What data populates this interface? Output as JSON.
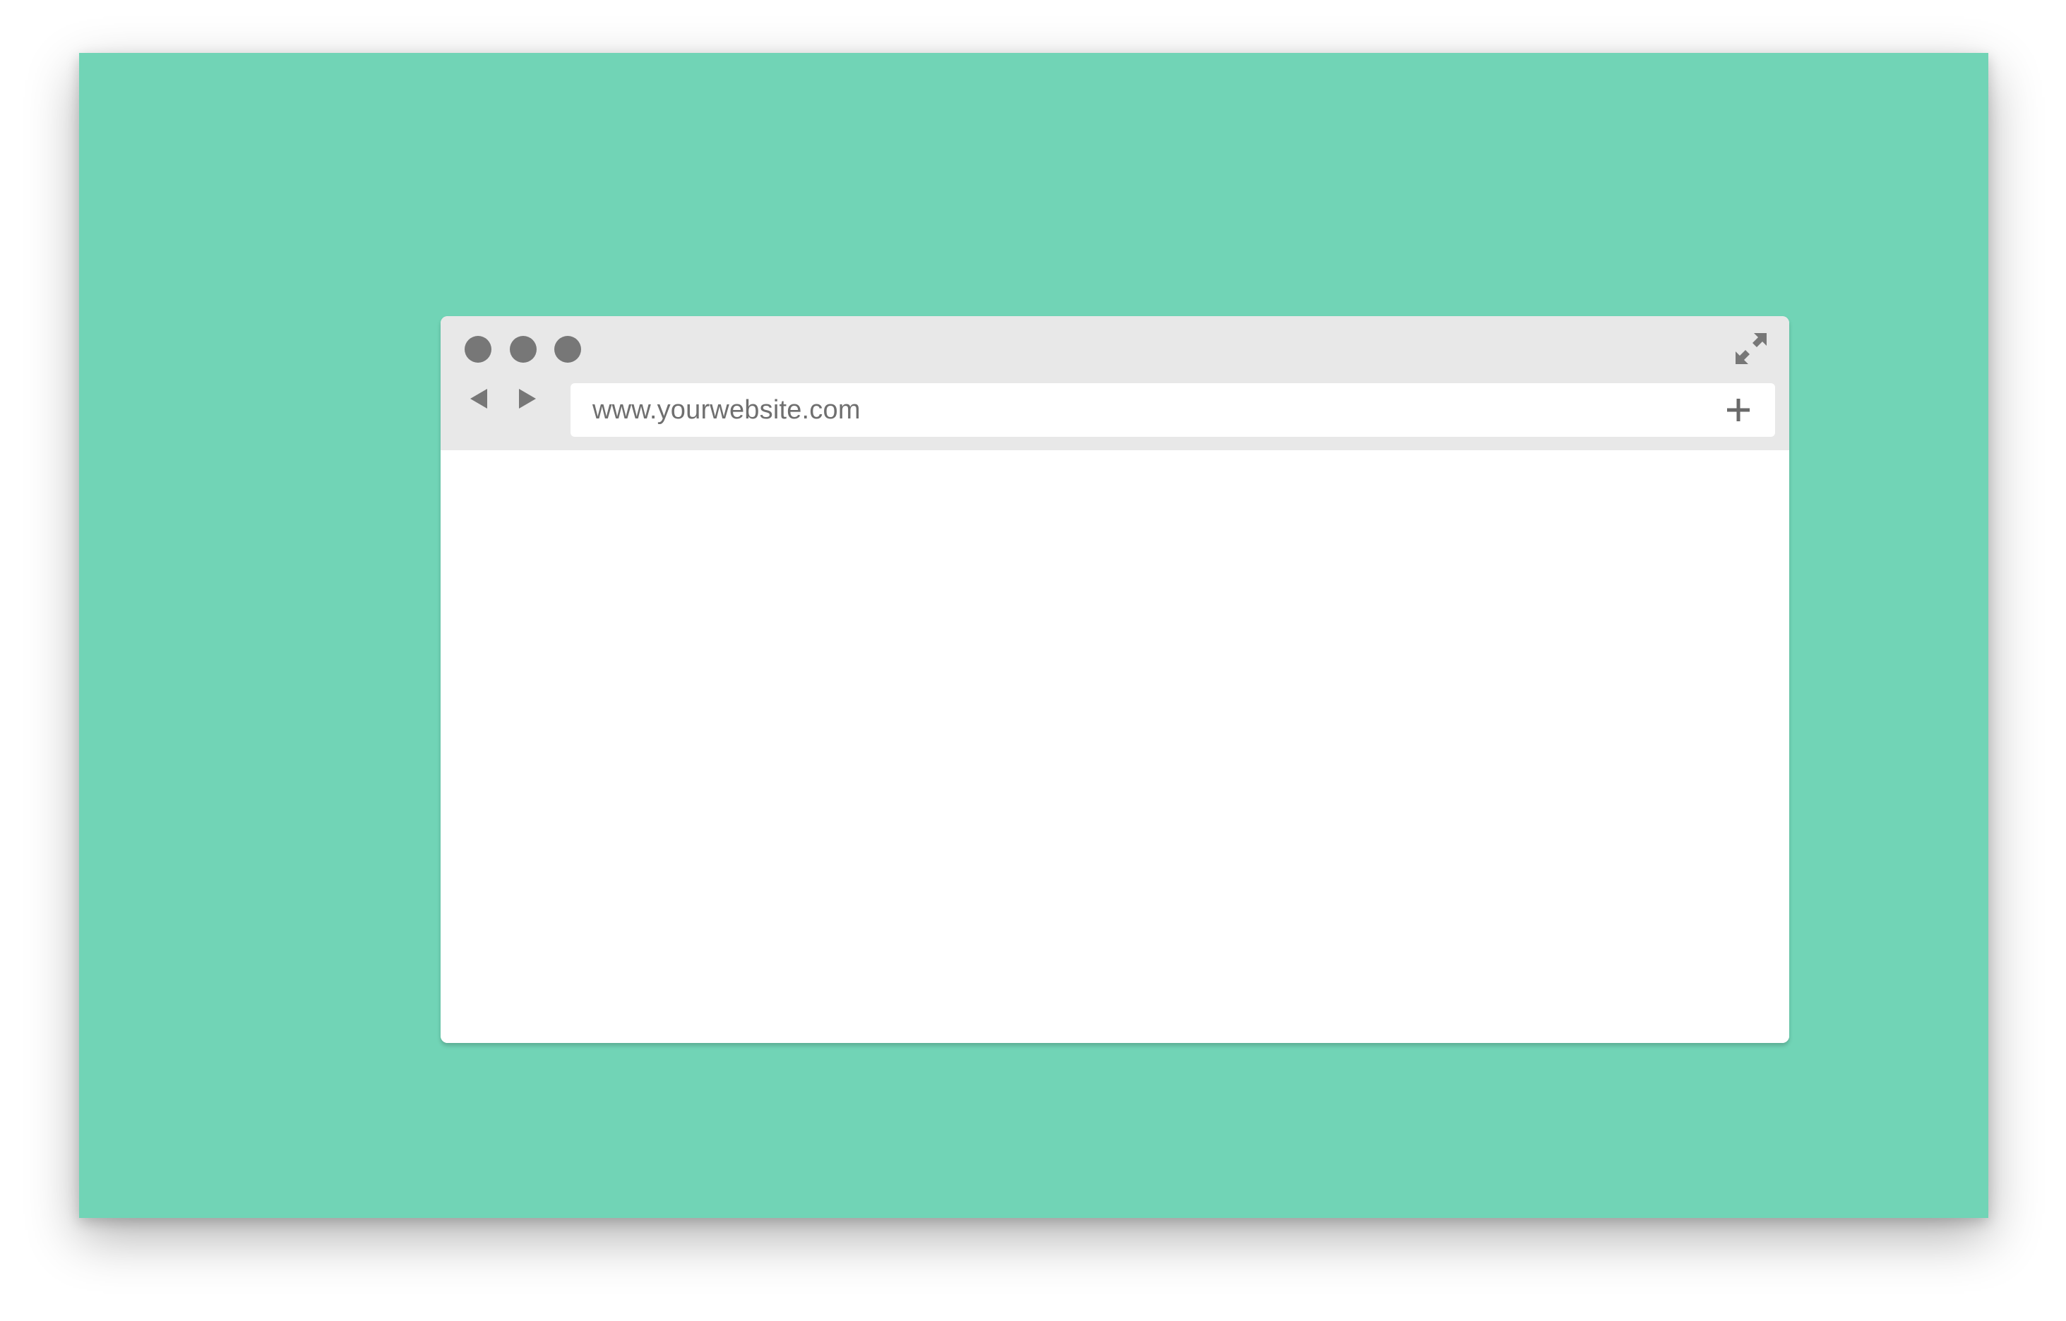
{
  "colors": {
    "background": "#71d4b6",
    "chrome": "#e8e8e8",
    "controls": "#777777",
    "address_text": "#6f6f6f",
    "content": "#ffffff"
  },
  "window": {
    "controls": [
      "close-dot",
      "minimize-dot",
      "zoom-dot"
    ],
    "expand_icon": "expand-arrows-icon"
  },
  "toolbar": {
    "back_icon": "back-arrow-icon",
    "forward_icon": "forward-arrow-icon",
    "url": "www.yourwebsite.com",
    "new_tab_icon": "plus-icon"
  }
}
